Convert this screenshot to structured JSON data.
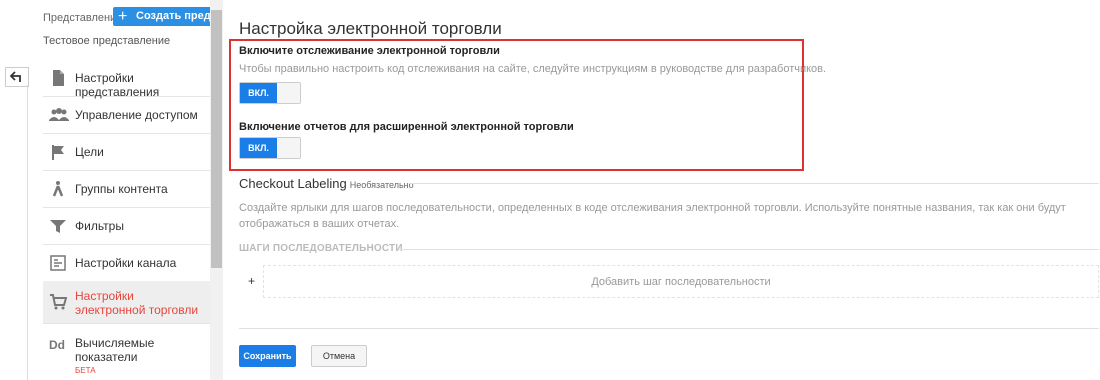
{
  "sidebar": {
    "view_label": "Представление",
    "create_button": "Создать представление",
    "test_view": "Тестовое представление",
    "back_icon": "back-arrow-icon",
    "items": [
      {
        "label": "Настройки представления",
        "icon": "document-icon"
      },
      {
        "label": "Управление доступом",
        "icon": "people-icon"
      },
      {
        "label": "Цели",
        "icon": "flag-icon"
      },
      {
        "label": "Группы контента",
        "icon": "person-walking-icon"
      },
      {
        "label": "Фильтры",
        "icon": "filter-icon"
      },
      {
        "label": "Настройки канала",
        "icon": "channel-settings-icon"
      },
      {
        "label": "Настройки электронной торговли",
        "icon": "cart-icon",
        "active": true
      },
      {
        "label": "Вычисляемые показатели",
        "badge": "БЕТА",
        "icon": "dd-icon"
      }
    ]
  },
  "main": {
    "title": "Настройка электронной торговли",
    "ecommerce": {
      "title": "Включите отслеживание электронной торговли",
      "desc": "Чтобы правильно настроить код отслеживания на сайте, следуйте инструкциям в руководстве для разработчиков.",
      "toggle_label": "ВКЛ."
    },
    "enhanced": {
      "title": "Включение отчетов для расширенной электронной торговли",
      "toggle_label": "ВКЛ."
    },
    "checkout": {
      "title": "Checkout Labeling",
      "optional": "Необязательно",
      "desc": "Создайте ярлыки для шагов последовательности, определенных в коде отслеживания электронной торговли. Используйте понятные названия, так как они будут отображаться в ваших отчетах."
    },
    "steps": {
      "title": "ШАГИ ПОСЛЕДОВАТЕЛЬНОСТИ",
      "plus": "+",
      "add_label": "Добавить шаг последовательности"
    },
    "save_label": "Сохранить",
    "cancel_label": "Отмена"
  },
  "colors": {
    "accent": "#1a7ee6",
    "active_text": "#e8453c",
    "highlight_box": "#e03131"
  }
}
